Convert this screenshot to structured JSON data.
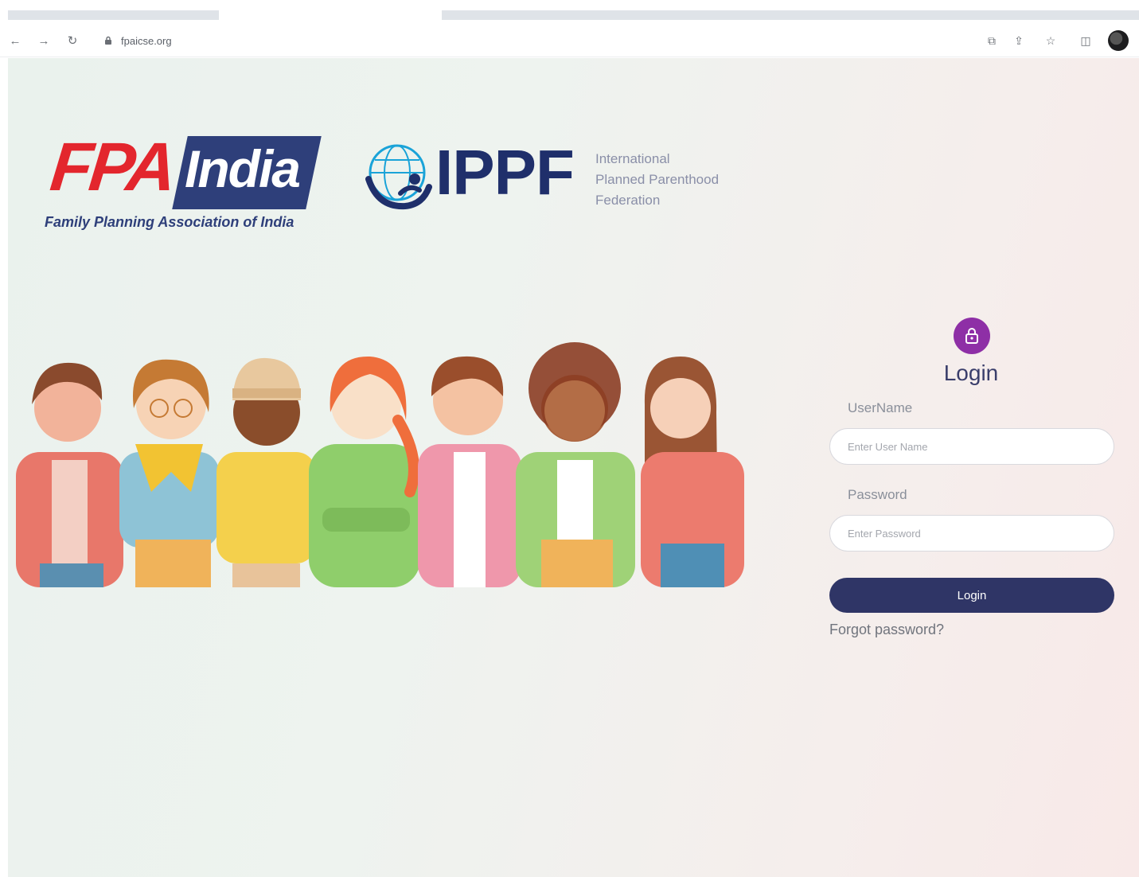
{
  "browser": {
    "url": "fpaicse.org",
    "colors": {
      "tab_bg": "#dfe3e8",
      "icon": "#6b6f75"
    },
    "icons": [
      "back-arrow-icon",
      "forward-arrow-icon",
      "reload-icon",
      "lock-icon",
      "screen-share-icon",
      "share-icon",
      "star-icon",
      "side-panel-icon",
      "profile-avatar"
    ]
  },
  "branding": {
    "fpa": {
      "mark": "FPA",
      "country": "India",
      "subtitle": "Family Planning Association of India",
      "colors": {
        "red": "#e3262d",
        "navy": "#2e3f7a"
      }
    },
    "ippf": {
      "mark": "IPPF",
      "line1": "International",
      "line2": "Planned Parenthood",
      "line3": "Federation",
      "colors": {
        "navy": "#1f2f6b",
        "cyan": "#1aa3d8"
      }
    }
  },
  "login": {
    "title": "Login",
    "username_label": "UserName",
    "username_placeholder": "Enter User Name",
    "password_label": "Password",
    "password_placeholder": "Enter Password",
    "submit_label": "Login",
    "forgot_label": "Forgot password?",
    "colors": {
      "lock_circle": "#8e2fa6",
      "button": "#2f3566",
      "title": "#3a3e6b"
    }
  }
}
